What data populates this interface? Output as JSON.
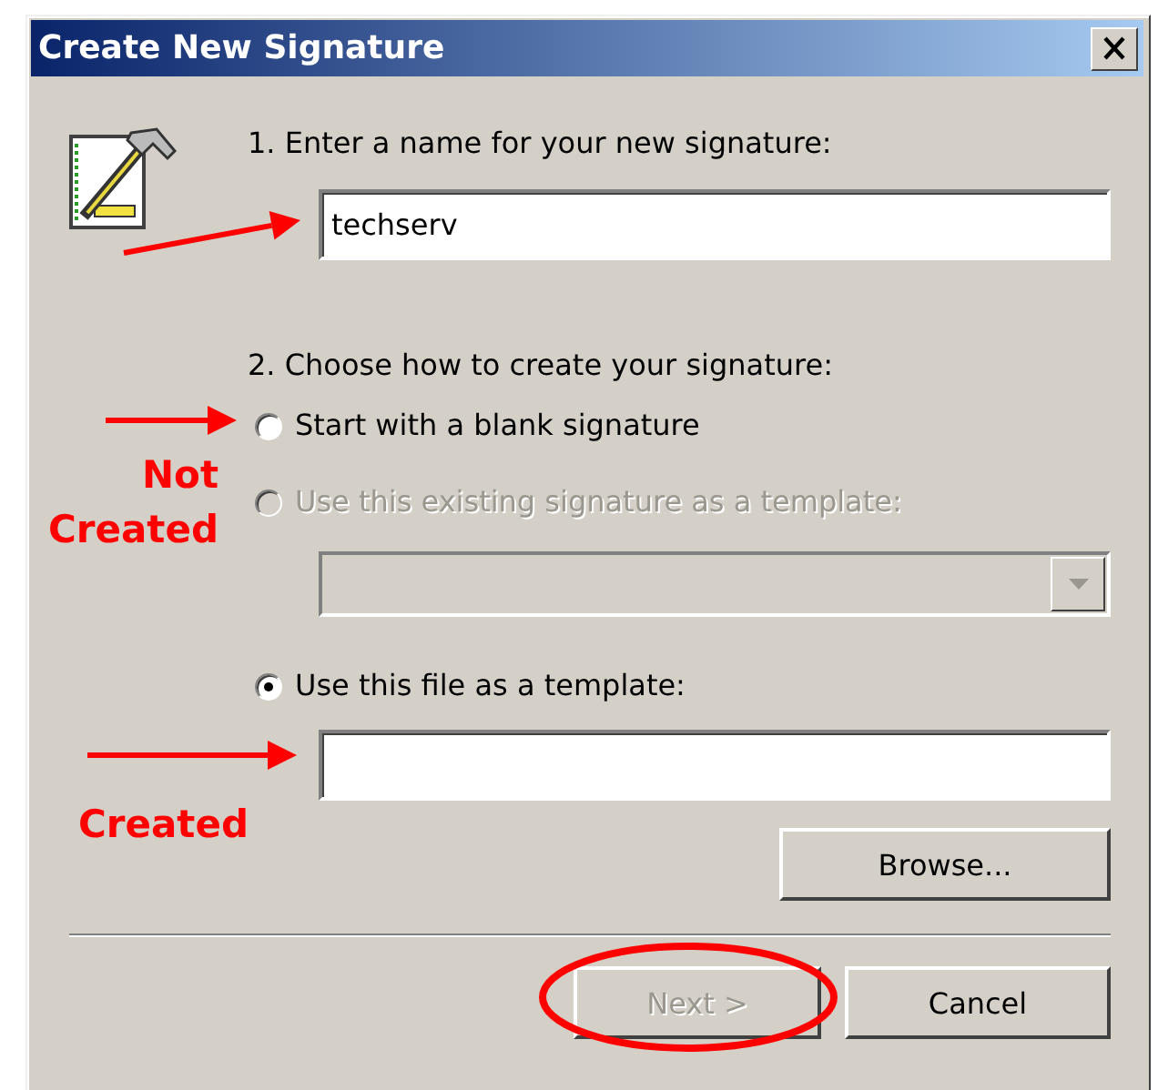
{
  "window": {
    "title": "Create New Signature"
  },
  "step1": {
    "label": "1. Enter a name for your new signature:",
    "name_field": {
      "value": "techserv"
    }
  },
  "step2": {
    "label": "2. Choose how to create your signature:",
    "options": [
      {
        "kind": "plain",
        "label": "Start with a blank signature",
        "selected": false,
        "disabled": false
      },
      {
        "kind": "combo",
        "label": "Use this existing signature as a template:",
        "selected": false,
        "disabled": true
      },
      {
        "kind": "file",
        "label": "Use this file as a template:",
        "selected": true,
        "disabled": false
      }
    ]
  },
  "browse_button": {
    "label": "Browse..."
  },
  "buttons": [
    {
      "label": "Next >",
      "disabled": true
    },
    {
      "label": "Cancel",
      "disabled": false
    }
  ],
  "annotations": [
    {
      "kind": "not_created",
      "text": "Not Created"
    },
    {
      "kind": "created",
      "text": "Created"
    }
  ]
}
